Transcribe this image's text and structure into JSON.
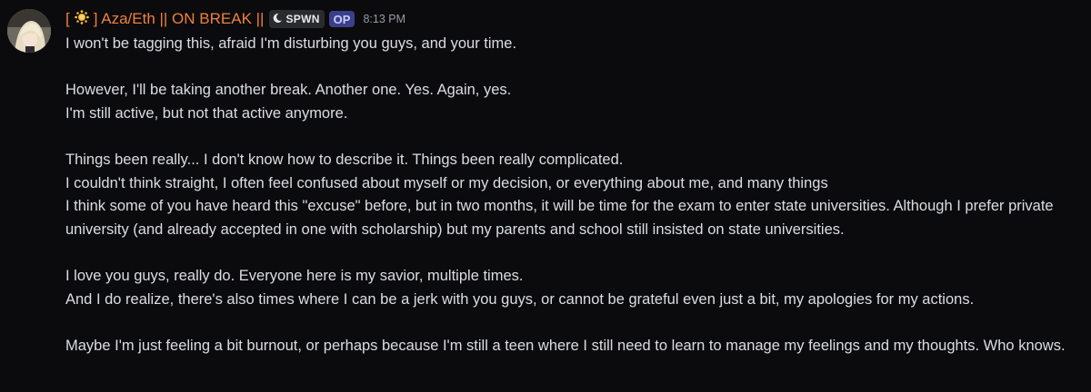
{
  "message": {
    "author": {
      "prefix": "[",
      "name_suffix": "] Aza/Eth || ON BREAK ||",
      "avatar_icon": "anime-avatar",
      "sun_icon": "sun-icon",
      "color": "#f0803c"
    },
    "server_tag": {
      "icon": "crescent-moon-icon",
      "label": "SPWN"
    },
    "op_badge": "OP",
    "timestamp": "8:13 PM",
    "paragraphs": [
      [
        "I won't be tagging this, afraid I'm disturbing you guys, and your time."
      ],
      [
        "However, I'll be taking another break. Another one. Yes. Again, yes.",
        "I'm still active, but not that active anymore."
      ],
      [
        "Things been really... I don't know how to describe it. Things been really complicated.",
        "I couldn't think straight, I often feel confused about myself or my decision, or everything about me, and many things",
        "I think some of you have heard this \"excuse\" before, but in two months, it will be time for the exam to enter state universities. Although I prefer private university (and already accepted in one with scholarship) but my parents and school still insisted on state universities."
      ],
      [
        "I love you guys, really do. Everyone here is my savior, multiple times.",
        "And I do realize, there's also times where I can be a jerk with you guys, or cannot be grateful even just a bit, my apologies for my actions."
      ],
      [
        "Maybe I'm just feeling a bit burnout, or perhaps because I'm still a teen where I still need to learn to manage my feelings and my thoughts. Who knows."
      ]
    ]
  }
}
